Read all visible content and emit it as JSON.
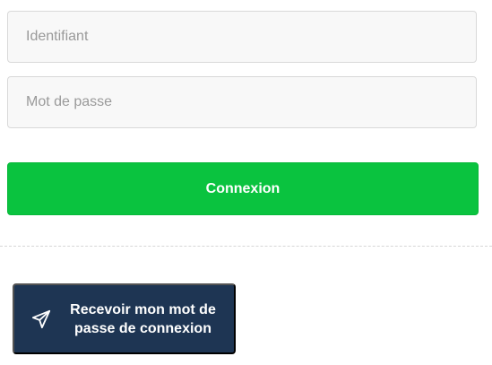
{
  "login_form": {
    "username_placeholder": "Identifiant",
    "username_value": "",
    "password_placeholder": "Mot de passe",
    "password_value": "",
    "submit_label": "Connexion"
  },
  "recovery": {
    "button_label": "Recevoir mon mot de passe de connexion",
    "button_icon": "paper-plane-icon"
  },
  "colors": {
    "submit_bg": "#0ac33f",
    "recovery_bg": "#1e3553",
    "field_bg": "#f8f8f8",
    "field_border": "#d9d9d9"
  }
}
